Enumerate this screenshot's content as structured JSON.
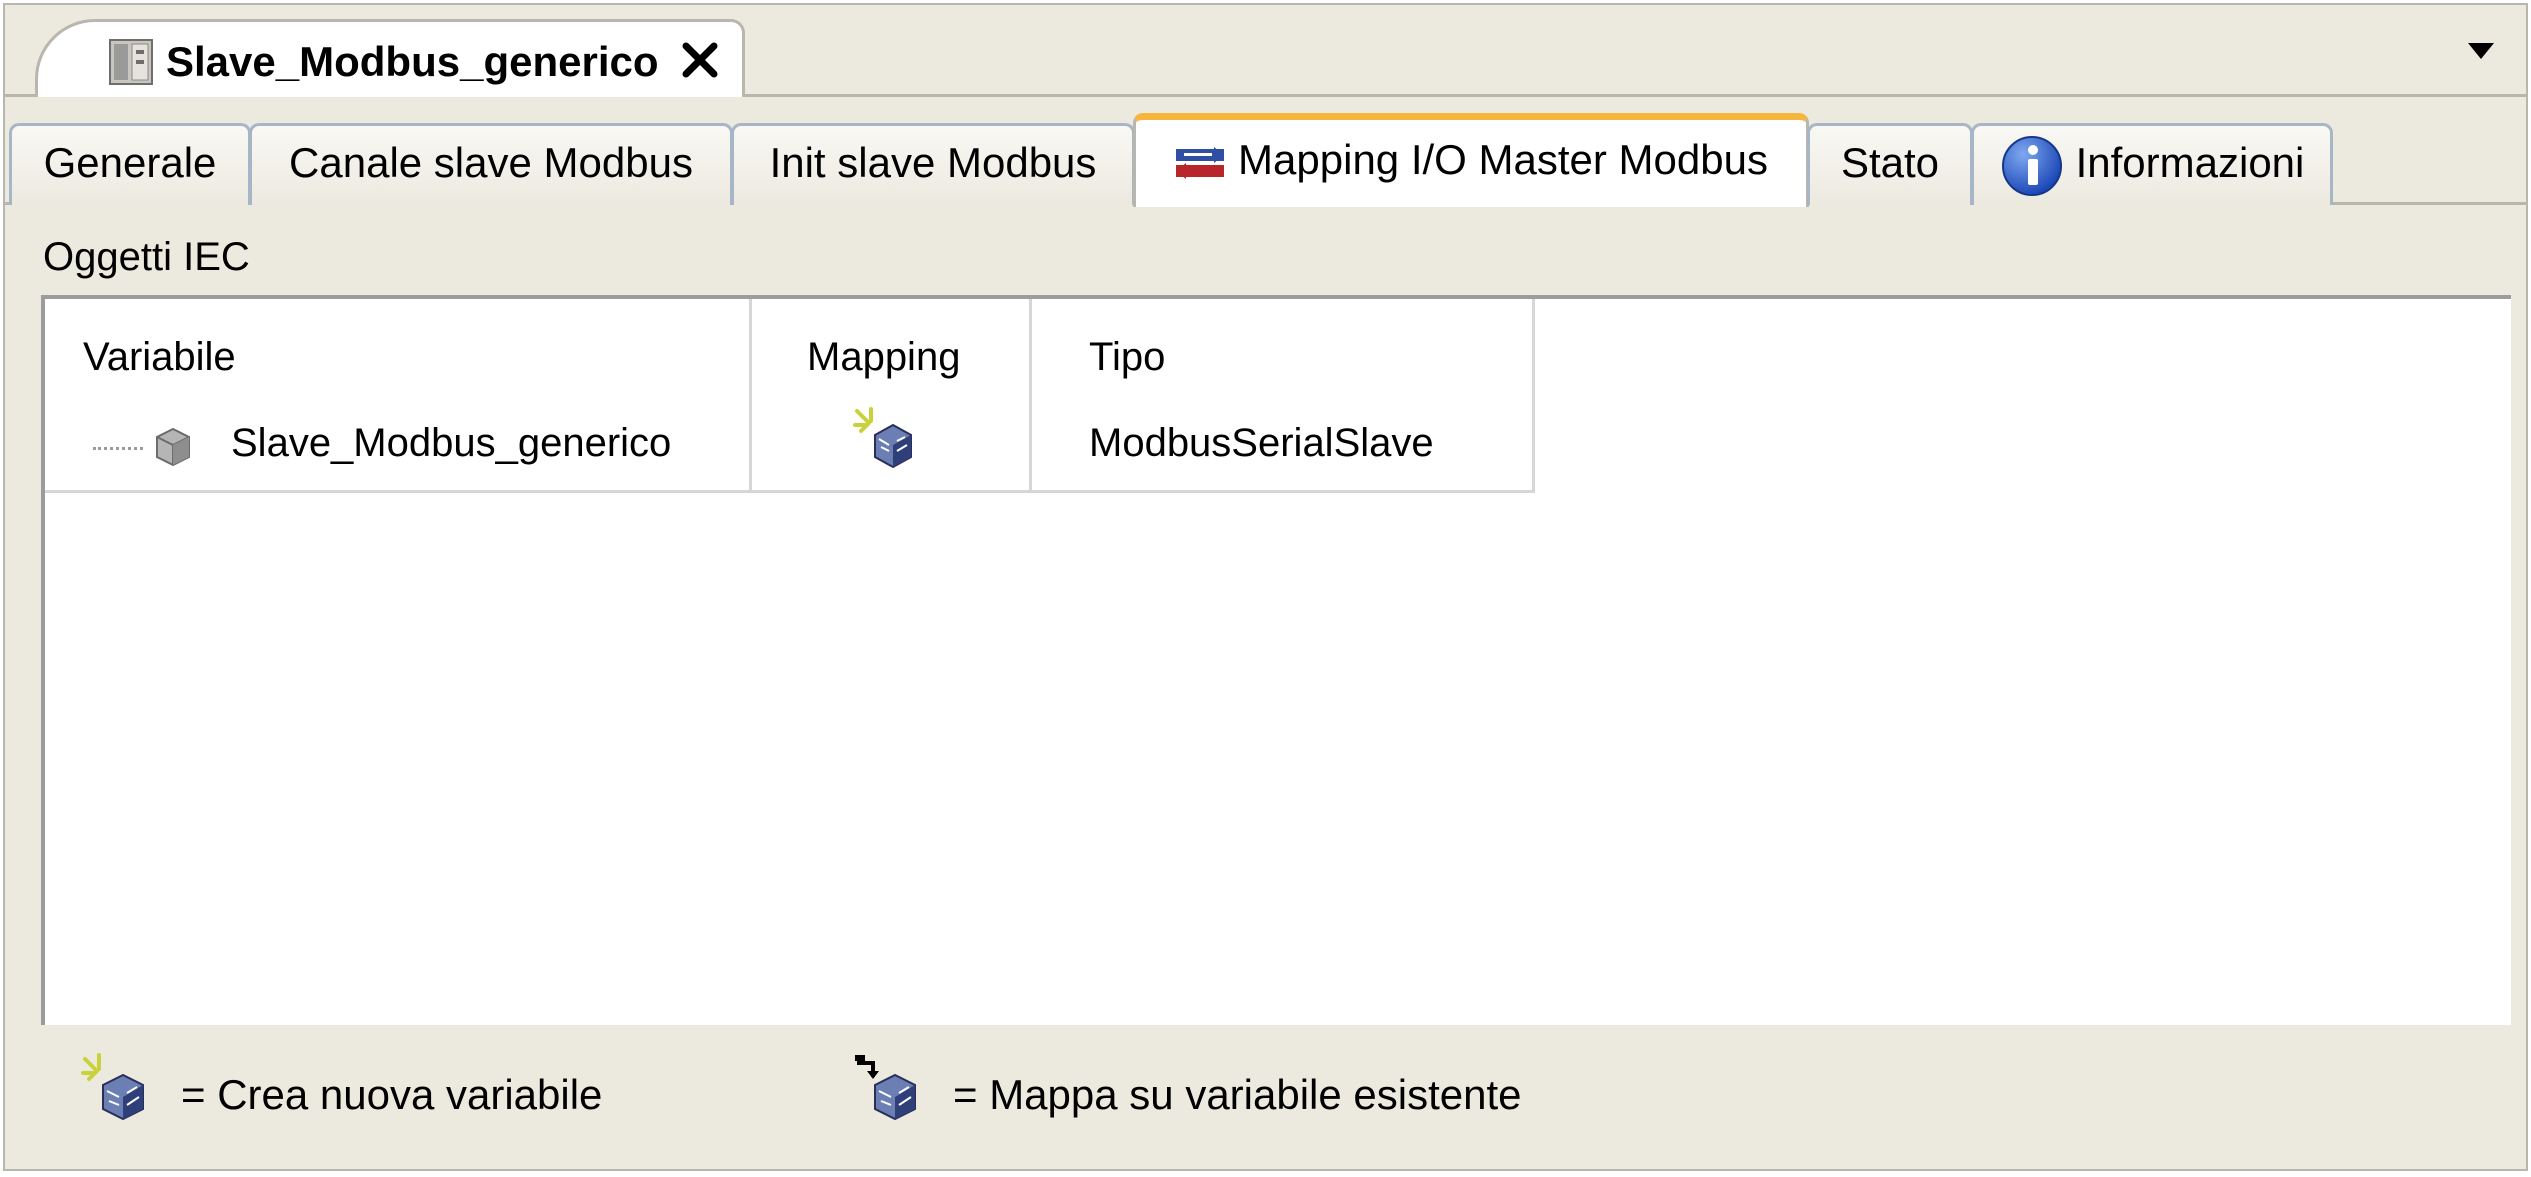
{
  "document_tab": {
    "title": "Slave_Modbus_generico",
    "icon": "device-icon",
    "close_icon": "close-icon"
  },
  "dropdown_icon": "chevron-down-icon",
  "tabs": [
    {
      "label": "Generale",
      "active": false
    },
    {
      "label": "Canale slave Modbus",
      "active": false
    },
    {
      "label": "Init slave Modbus",
      "active": false
    },
    {
      "label": "Mapping I/O Master Modbus",
      "active": true,
      "icon": "mapping-arrows-icon"
    },
    {
      "label": "Stato",
      "active": false
    },
    {
      "label": "Informazioni",
      "active": false,
      "icon": "info-icon"
    }
  ],
  "section": {
    "label": "Oggetti IEC"
  },
  "table": {
    "columns": [
      "Variabile",
      "Mapping",
      "Tipo"
    ],
    "rows": [
      {
        "variable": "Slave_Modbus_generico",
        "mapping_icon": "new-variable-icon",
        "type": "ModbusSerialSlave"
      }
    ]
  },
  "legend": {
    "new_variable": {
      "icon": "new-variable-icon",
      "text": "= Crea nuova variabile"
    },
    "existing_variable": {
      "icon": "map-existing-variable-icon",
      "text": "= Mappa su variabile esistente"
    }
  },
  "colors": {
    "background": "#ece9df",
    "active_tab_accent": "#f6b53d",
    "tab_border": "#a7b6c7"
  }
}
